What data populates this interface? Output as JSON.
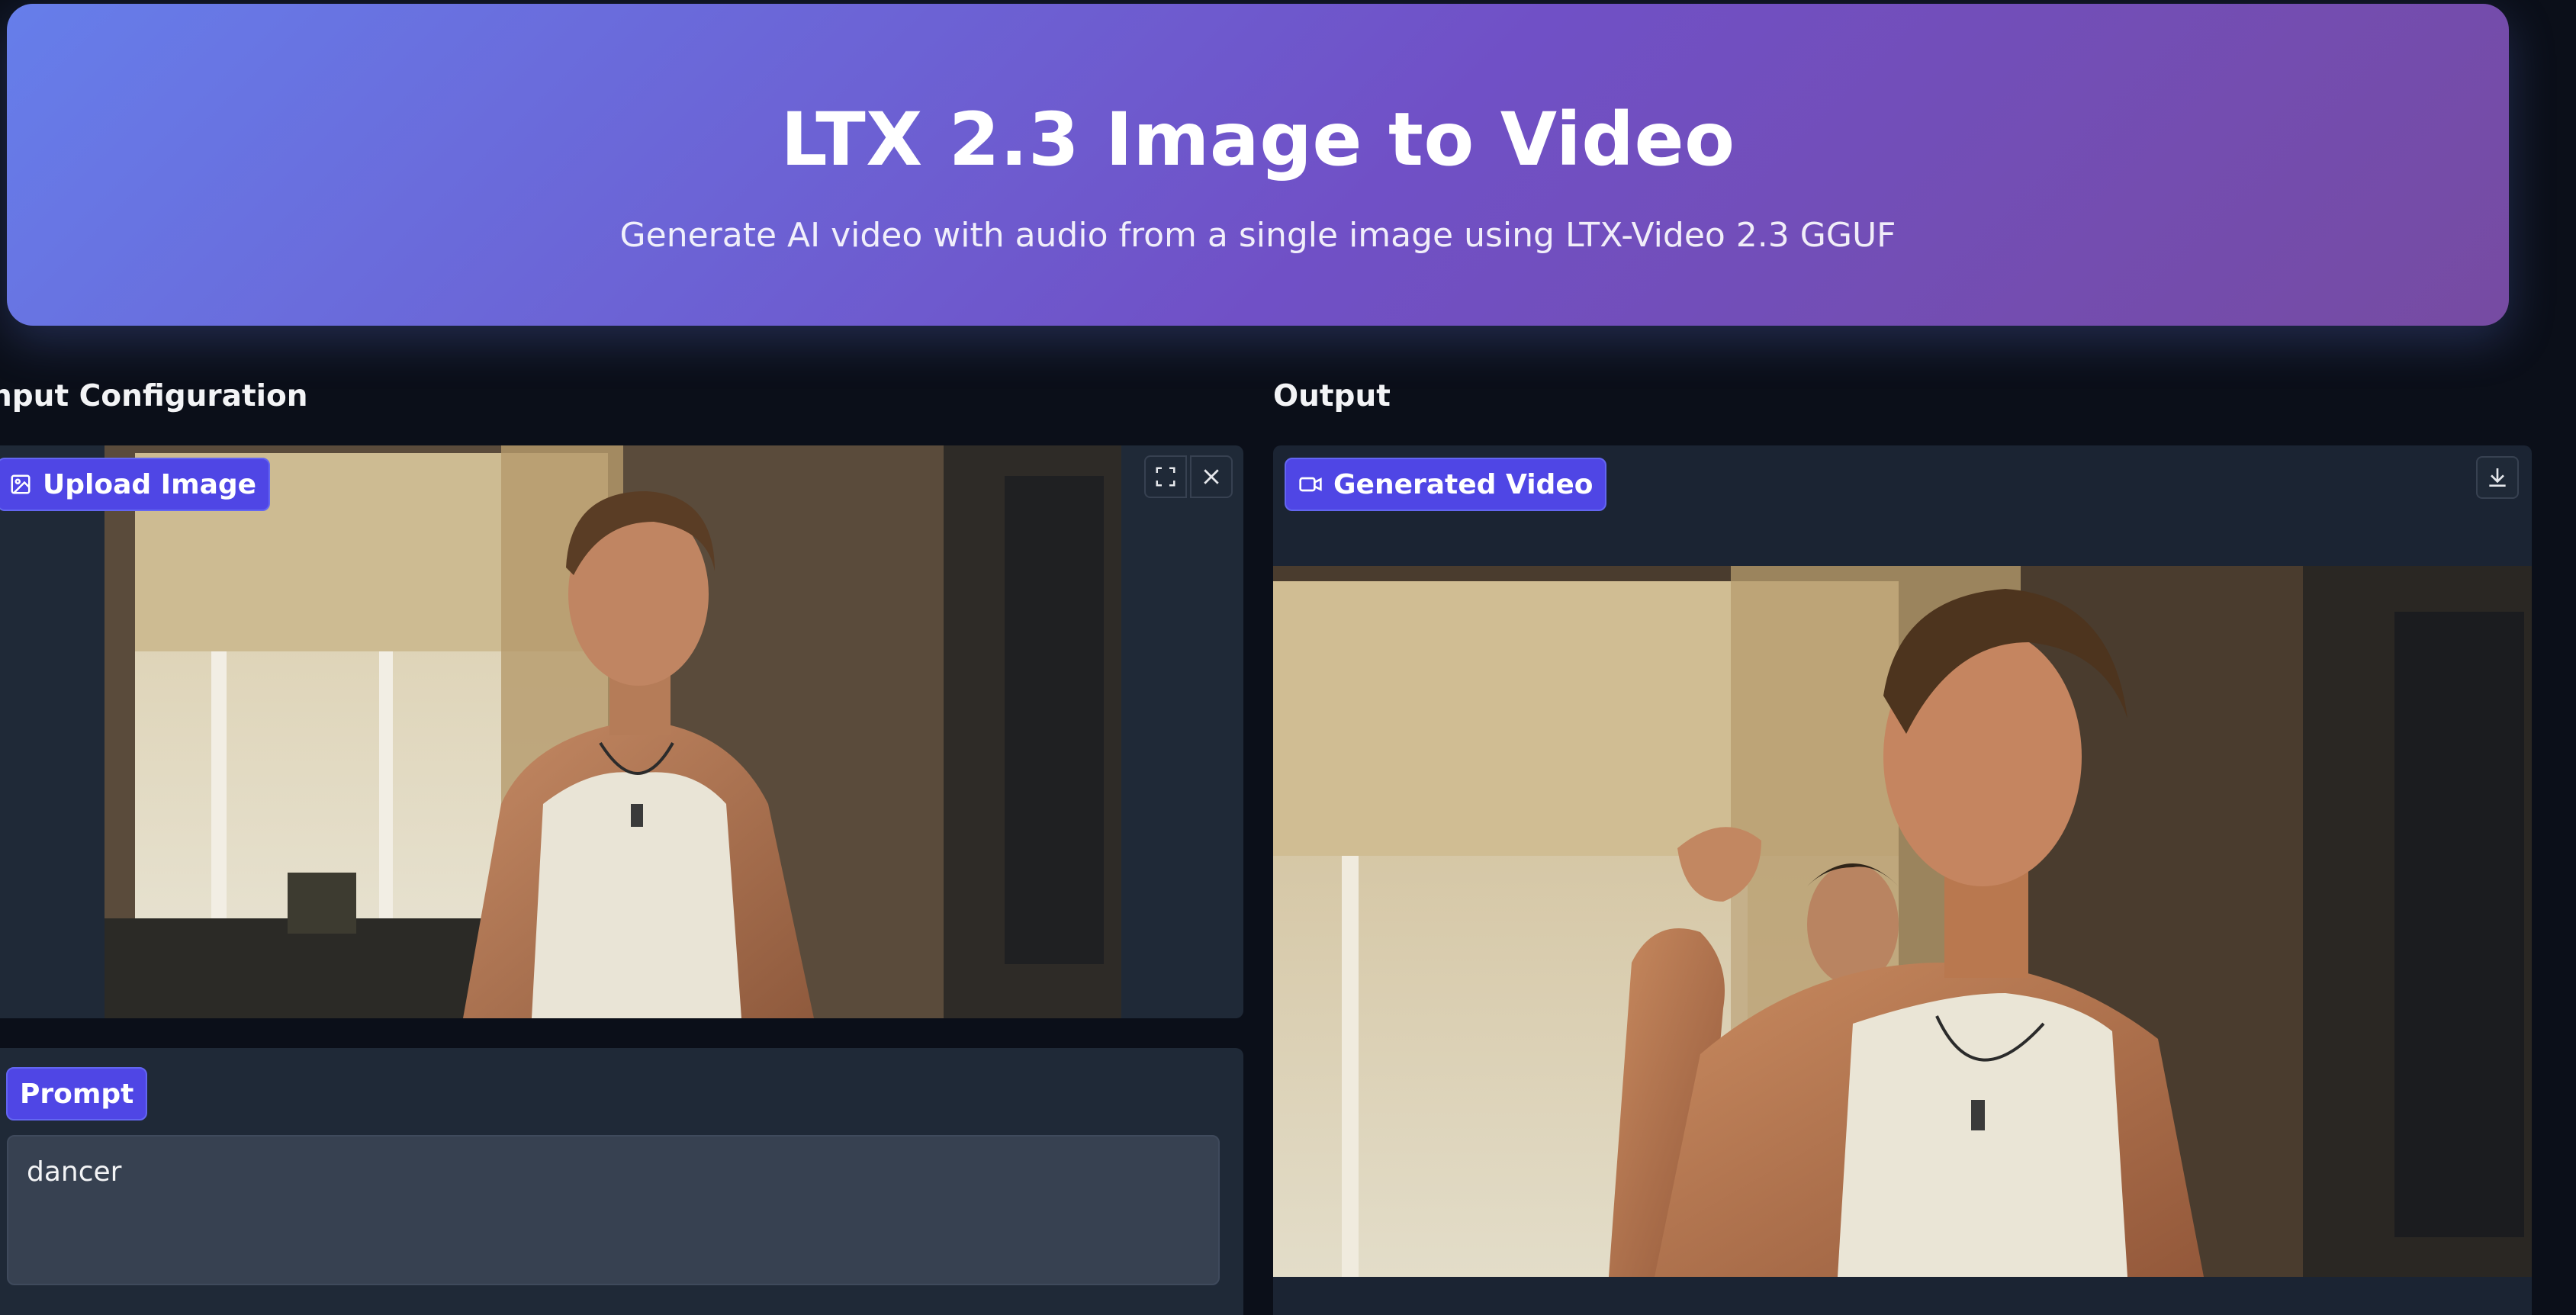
{
  "header": {
    "title": "LTX 2.3 Image to Video",
    "subtitle": "Generate AI video with audio from a single image using LTX-Video 2.3 GGUF"
  },
  "input": {
    "section_label": "nput Configuration",
    "upload": {
      "label": "Upload Image",
      "icon": "image-icon",
      "actions": [
        "fullscreen-icon",
        "close-icon"
      ]
    },
    "prompt": {
      "label": "Prompt",
      "value": "dancer"
    }
  },
  "output": {
    "section_label": "Output",
    "video": {
      "label": "Generated Video",
      "icon": "video-camera-icon",
      "actions": [
        "download-icon"
      ]
    }
  },
  "colors": {
    "background": "#0b0f19",
    "panel": "#1f2937",
    "accent": "#4f46e5",
    "header_gradient_start": "#667eea",
    "header_gradient_end": "#764ba2"
  }
}
